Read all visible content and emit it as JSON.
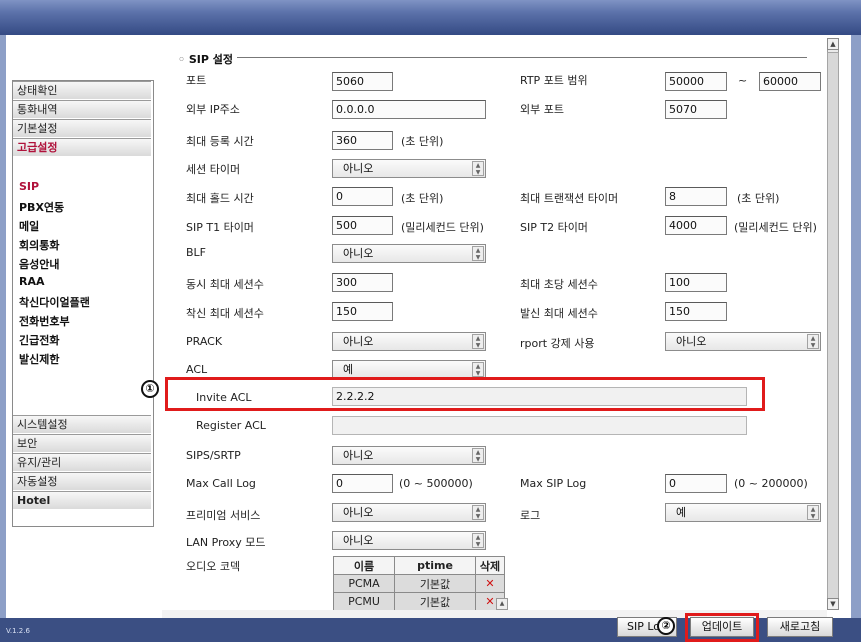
{
  "version": "V.1.2.6",
  "sidebar": {
    "categories": [
      {
        "label": "상태확인"
      },
      {
        "label": "통화내역"
      },
      {
        "label": "기본설정"
      },
      {
        "label": "고급설정"
      },
      {
        "label": "시스템설정"
      },
      {
        "label": "보안"
      },
      {
        "label": "유지/관리"
      },
      {
        "label": "자동설정"
      },
      {
        "label": "Hotel"
      }
    ],
    "subitems": [
      {
        "label": "SIP"
      },
      {
        "label": "PBX연동"
      },
      {
        "label": "메일"
      },
      {
        "label": "회의통화"
      },
      {
        "label": "음성안내"
      },
      {
        "label": "RAA"
      },
      {
        "label": "착신다이얼플랜"
      },
      {
        "label": "전화번호부"
      },
      {
        "label": "긴급전화"
      },
      {
        "label": "발신제한"
      }
    ]
  },
  "section": {
    "title": "SIP 설정"
  },
  "form": {
    "port": {
      "label": "포트",
      "value": "5060"
    },
    "rtp_range": {
      "label": "RTP 포트 범위",
      "from": "50000",
      "sep": "~",
      "to": "60000"
    },
    "ext_ip": {
      "label": "외부 IP주소",
      "value": "0.0.0.0"
    },
    "ext_port": {
      "label": "외부 포트",
      "value": "5070"
    },
    "max_reg": {
      "label": "최대 등록 시간",
      "value": "360",
      "unit": "(초 단위)"
    },
    "session_timer": {
      "label": "세션 타이머",
      "value": "아니오"
    },
    "max_hold": {
      "label": "최대 홀드 시간",
      "value": "0",
      "unit": "(초 단위)"
    },
    "max_trans": {
      "label": "최대 트랜잭션 타이머",
      "value": "8",
      "unit": "(초 단위)"
    },
    "t1": {
      "label": "SIP T1 타이머",
      "value": "500",
      "unit": "(밀리세컨드 단위)"
    },
    "t2": {
      "label": "SIP T2 타이머",
      "value": "4000",
      "unit": "(밀리세컨드 단위)"
    },
    "blf": {
      "label": "BLF",
      "value": "아니오"
    },
    "max_sessions": {
      "label": "동시 최대 세션수",
      "value": "300"
    },
    "max_per_sec": {
      "label": "최대 초당 세션수",
      "value": "100"
    },
    "in_max": {
      "label": "착신 최대 세션수",
      "value": "150"
    },
    "out_max": {
      "label": "발신 최대 세션수",
      "value": "150"
    },
    "prack": {
      "label": "PRACK",
      "value": "아니오"
    },
    "rport": {
      "label": "rport 강제 사용",
      "value": "아니오"
    },
    "acl": {
      "label": "ACL",
      "value": "예"
    },
    "invite_acl": {
      "label": "Invite ACL",
      "value": "2.2.2.2"
    },
    "register_acl": {
      "label": "Register ACL",
      "value": ""
    },
    "sips": {
      "label": "SIPS/SRTP",
      "value": "아니오"
    },
    "max_call_log": {
      "label": "Max Call Log",
      "value": "0",
      "range": "(0 ~ 500000)"
    },
    "max_sip_log": {
      "label": "Max SIP Log",
      "value": "0",
      "range": "(0 ~ 200000)"
    },
    "premium": {
      "label": "프리미엄 서비스",
      "value": "아니오"
    },
    "log": {
      "label": "로그",
      "value": "예"
    },
    "lan_proxy": {
      "label": "LAN Proxy 모드",
      "value": "아니오"
    },
    "codec": {
      "label": "오디오 코덱",
      "headers": [
        "이름",
        "ptime",
        "삭제"
      ],
      "rows": [
        {
          "name": "PCMA",
          "ptime": "기본값",
          "del": "✕"
        },
        {
          "name": "PCMU",
          "ptime": "기본값",
          "del": "✕"
        }
      ]
    }
  },
  "annotations": {
    "one": "①",
    "two": "②"
  },
  "buttons": {
    "sip_log": "SIP Log",
    "update": "업데이트",
    "refresh": "새로고침"
  },
  "colors": {
    "header": "#344a84",
    "accent": "#b0123b",
    "highlight": "#e01b1b"
  }
}
